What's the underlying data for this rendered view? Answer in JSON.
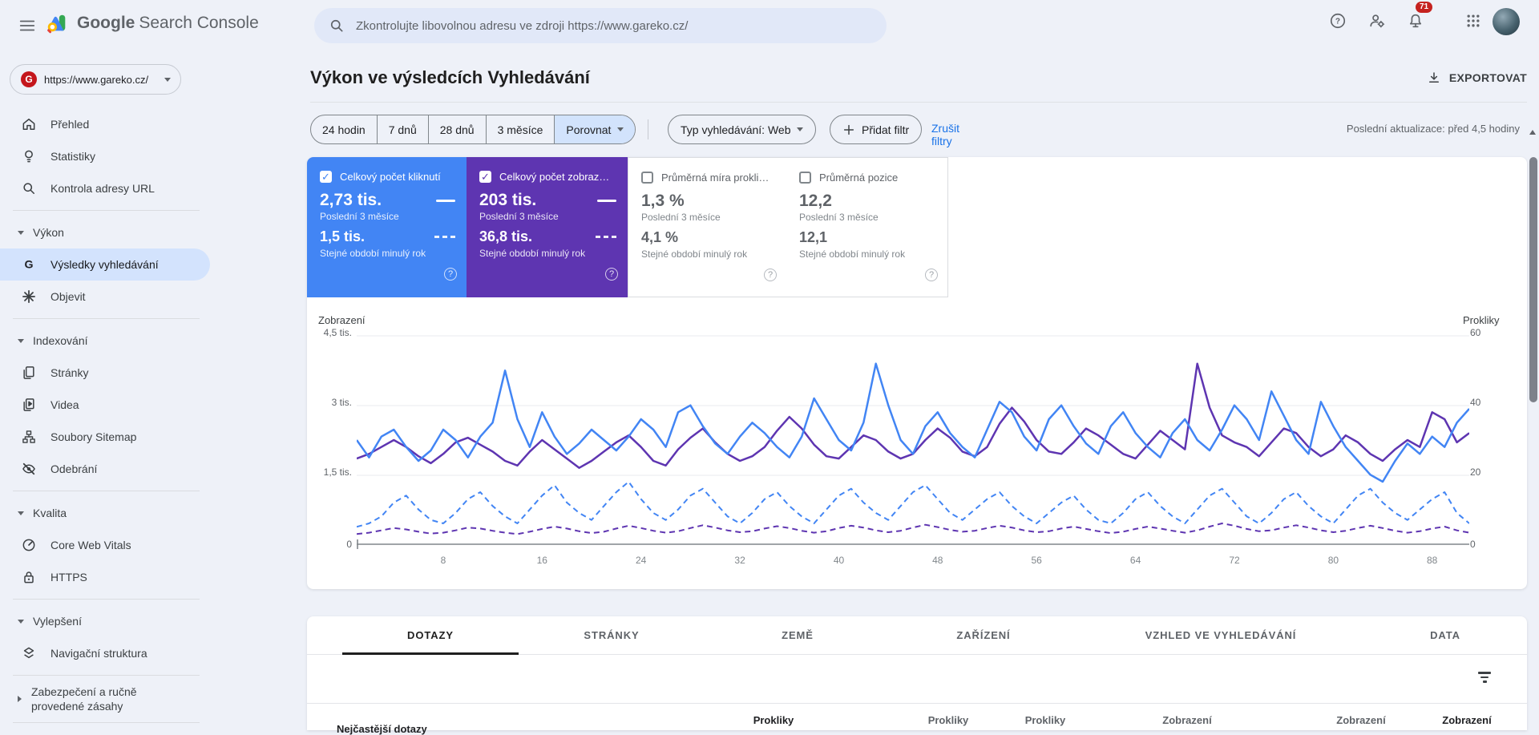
{
  "colors": {
    "accent_blue": "#4285f4",
    "accent_purple": "#5e35b1",
    "link_blue": "#1a73e8",
    "badge_red": "#c5221f",
    "active_pill": "#d3e3fd",
    "page_background": "#eef1f8"
  },
  "header": {
    "product_name_bold": "Google",
    "product_name_rest": "Search Console",
    "search_placeholder": "Zkontrolujte libovolnou adresu ve zdroji https://www.gareko.cz/",
    "notification_count": "71"
  },
  "property": {
    "url": "https://www.gareko.cz/",
    "favicon_letter": "G"
  },
  "sidebar": {
    "top_items": [
      {
        "icon": "home-icon",
        "label": "Přehled"
      },
      {
        "icon": "lightbulb-icon",
        "label": "Statistiky"
      },
      {
        "icon": "search-icon",
        "label": "Kontrola adresy URL"
      }
    ],
    "sections": [
      {
        "label": "Výkon",
        "items": [
          {
            "icon": "google-g-icon",
            "label": "Výsledky vyhledávání",
            "active": true
          },
          {
            "icon": "discover-asterisk-icon",
            "label": "Objevit",
            "active": false
          }
        ]
      },
      {
        "label": "Indexování",
        "items": [
          {
            "icon": "pages-icon",
            "label": "Stránky",
            "active": false
          },
          {
            "icon": "video-icon",
            "label": "Videa",
            "active": false
          },
          {
            "icon": "sitemap-icon",
            "label": "Soubory Sitemap",
            "active": false
          },
          {
            "icon": "eye-off-icon",
            "label": "Odebrání",
            "active": false
          }
        ]
      },
      {
        "label": "Kvalita",
        "items": [
          {
            "icon": "gauge-icon",
            "label": "Core Web Vitals",
            "active": false
          },
          {
            "icon": "lock-icon",
            "label": "HTTPS",
            "active": false
          }
        ]
      },
      {
        "label": "Vylepšení",
        "items": [
          {
            "icon": "layers-icon",
            "label": "Navigační struktura",
            "active": false
          }
        ]
      }
    ],
    "collapsed_item": {
      "label": "Zabezpečení a ručně provedené zásahy"
    }
  },
  "page": {
    "title": "Výkon ve výsledcích Vyhledávání",
    "export_label": "EXPORTOVAT",
    "last_update": "Poslední aktualizace: před 4,5 hodiny"
  },
  "filters": {
    "date_ranges": [
      "24 hodin",
      "7 dnů",
      "28 dnů",
      "3 měsíce"
    ],
    "compare_label": "Porovnat",
    "search_type": "Typ vyhledávání: Web",
    "add_filter": "Přidat filtr",
    "clear_filters": "Zrušit filtry"
  },
  "metrics": [
    {
      "label": "Celkový počet kliknutí",
      "checked": true,
      "color": "#4285f4",
      "value_current": "2,73 tis.",
      "period_current": "Poslední 3 měsíce",
      "value_previous": "1,5 tis.",
      "period_previous": "Stejné období minulý rok"
    },
    {
      "label": "Celkový počet zobraz…",
      "checked": true,
      "color": "#5e35b1",
      "value_current": "203 tis.",
      "period_current": "Poslední 3 měsíce",
      "value_previous": "36,8 tis.",
      "period_previous": "Stejné období minulý rok"
    },
    {
      "label": "Průměrná míra prokli…",
      "checked": false,
      "color": "#ffffff",
      "value_current": "1,3 %",
      "period_current": "Poslední 3 měsíce",
      "value_previous": "4,1 %",
      "period_previous": "Stejné období minulý rok"
    },
    {
      "label": "Průměrná pozice",
      "checked": false,
      "color": "#ffffff",
      "value_current": "12,2",
      "period_current": "Poslední 3 měsíce",
      "value_previous": "12,1",
      "period_previous": "Stejné období minulý rok"
    }
  ],
  "chart_data": {
    "type": "line",
    "x_count": 91,
    "x_ticks": [
      8,
      16,
      24,
      32,
      40,
      48,
      56,
      64,
      72,
      80,
      88
    ],
    "left_axis_label": "Zobrazení",
    "right_axis_label": "Prokliky",
    "left_ticks": [
      "4,5 tis.",
      "3 tis.",
      "1,5 tis.",
      "0"
    ],
    "right_ticks": [
      "60",
      "40",
      "20",
      "0"
    ],
    "left_ylim": [
      0,
      4500
    ],
    "right_ylim": [
      0,
      60
    ],
    "grid": true,
    "legend_position": "none",
    "series": [
      {
        "id": "impressions-previous",
        "name": "Zobrazení (Stejné období minulý rok)",
        "axis": "left",
        "color": "#5e35b1",
        "dashed": true,
        "values": [
          220,
          250,
          300,
          350,
          320,
          270,
          230,
          250,
          300,
          360,
          340,
          290,
          250,
          220,
          270,
          330,
          380,
          340,
          280,
          240,
          270,
          340,
          400,
          350,
          290,
          250,
          280,
          350,
          410,
          360,
          300,
          260,
          280,
          340,
          390,
          350,
          290,
          250,
          280,
          350,
          400,
          360,
          300,
          260,
          290,
          360,
          420,
          370,
          310,
          270,
          290,
          350,
          400,
          360,
          300,
          260,
          280,
          340,
          380,
          330,
          280,
          240,
          270,
          330,
          380,
          340,
          290,
          250,
          300,
          380,
          450,
          400,
          330,
          280,
          300,
          360,
          410,
          360,
          300,
          260,
          290,
          350,
          400,
          350,
          290,
          250,
          280,
          340,
          380,
          300,
          250
        ]
      },
      {
        "id": "clicks-previous",
        "name": "Prokliky (Stejné období minulý rok)",
        "axis": "right",
        "color": "#4285f4",
        "dashed": true,
        "values": [
          5,
          6,
          8,
          12,
          14,
          10,
          7,
          6,
          9,
          13,
          15,
          11,
          8,
          6,
          10,
          14,
          17,
          12,
          9,
          7,
          11,
          15,
          18,
          13,
          9,
          7,
          10,
          14,
          16,
          12,
          8,
          6,
          9,
          13,
          15,
          11,
          8,
          6,
          10,
          14,
          16,
          12,
          9,
          7,
          11,
          15,
          17,
          13,
          9,
          7,
          10,
          13,
          15,
          11,
          8,
          6,
          9,
          12,
          14,
          10,
          7,
          6,
          9,
          13,
          15,
          11,
          8,
          6,
          10,
          14,
          16,
          12,
          8,
          6,
          9,
          13,
          15,
          11,
          8,
          6,
          10,
          14,
          16,
          12,
          9,
          7,
          10,
          13,
          15,
          9,
          6
        ]
      },
      {
        "id": "impressions-current",
        "name": "Zobrazení (Poslední 3 měsíce)",
        "axis": "left",
        "color": "#5e35b1",
        "dashed": false,
        "values": [
          1850,
          1950,
          2100,
          2250,
          2100,
          1900,
          1750,
          1950,
          2200,
          2300,
          2150,
          2000,
          1800,
          1700,
          2000,
          2250,
          2050,
          1850,
          1650,
          1800,
          2000,
          2200,
          2350,
          2100,
          1800,
          1700,
          2050,
          2300,
          2500,
          2200,
          1950,
          1800,
          1900,
          2100,
          2450,
          2750,
          2500,
          2150,
          1900,
          1850,
          2100,
          2350,
          2250,
          2000,
          1850,
          1950,
          2250,
          2500,
          2300,
          2000,
          1900,
          2100,
          2600,
          2950,
          2650,
          2250,
          2000,
          1950,
          2200,
          2500,
          2350,
          2150,
          1950,
          1850,
          2150,
          2450,
          2250,
          2050,
          3900,
          2950,
          2350,
          2200,
          2100,
          1900,
          2200,
          2500,
          2400,
          2100,
          1900,
          2050,
          2350,
          2200,
          1950,
          1800,
          2050,
          2250,
          2100,
          2850,
          2700,
          2200,
          2400
        ]
      },
      {
        "id": "clicks-current",
        "name": "Prokliky (Poslední 3 měsíce)",
        "axis": "right",
        "color": "#4285f4",
        "dashed": false,
        "values": [
          30,
          25,
          31,
          33,
          28,
          24,
          27,
          33,
          30,
          25,
          31,
          35,
          50,
          36,
          28,
          38,
          31,
          26,
          29,
          33,
          30,
          27,
          31,
          36,
          33,
          28,
          38,
          40,
          34,
          29,
          26,
          31,
          35,
          32,
          28,
          25,
          31,
          42,
          36,
          30,
          27,
          35,
          52,
          40,
          30,
          26,
          34,
          38,
          32,
          28,
          25,
          33,
          41,
          38,
          31,
          27,
          36,
          40,
          34,
          29,
          26,
          34,
          38,
          32,
          28,
          25,
          32,
          36,
          30,
          27,
          33,
          40,
          36,
          30,
          44,
          37,
          30,
          26,
          41,
          34,
          28,
          24,
          20,
          18,
          24,
          29,
          26,
          31,
          28,
          35,
          39
        ]
      }
    ]
  },
  "tabs": [
    "DOTAZY",
    "STRÁNKY",
    "ZEMĚ",
    "ZAŘÍZENÍ",
    "VZHLED VE VYHLEDÁVÁNÍ",
    "DATA"
  ],
  "table": {
    "first_column_header": "Nejčastější dotazy",
    "metric_headers": [
      {
        "label": "Prokliky",
        "emphasized": true
      },
      {
        "label": "Prokliky",
        "emphasized": false
      },
      {
        "label": "Prokliky",
        "emphasized": false
      },
      {
        "label": "Zobrazení",
        "emphasized": false
      },
      {
        "label": "Zobrazení",
        "emphasized": false
      },
      {
        "label": "Zobrazení",
        "emphasized": true
      }
    ]
  }
}
